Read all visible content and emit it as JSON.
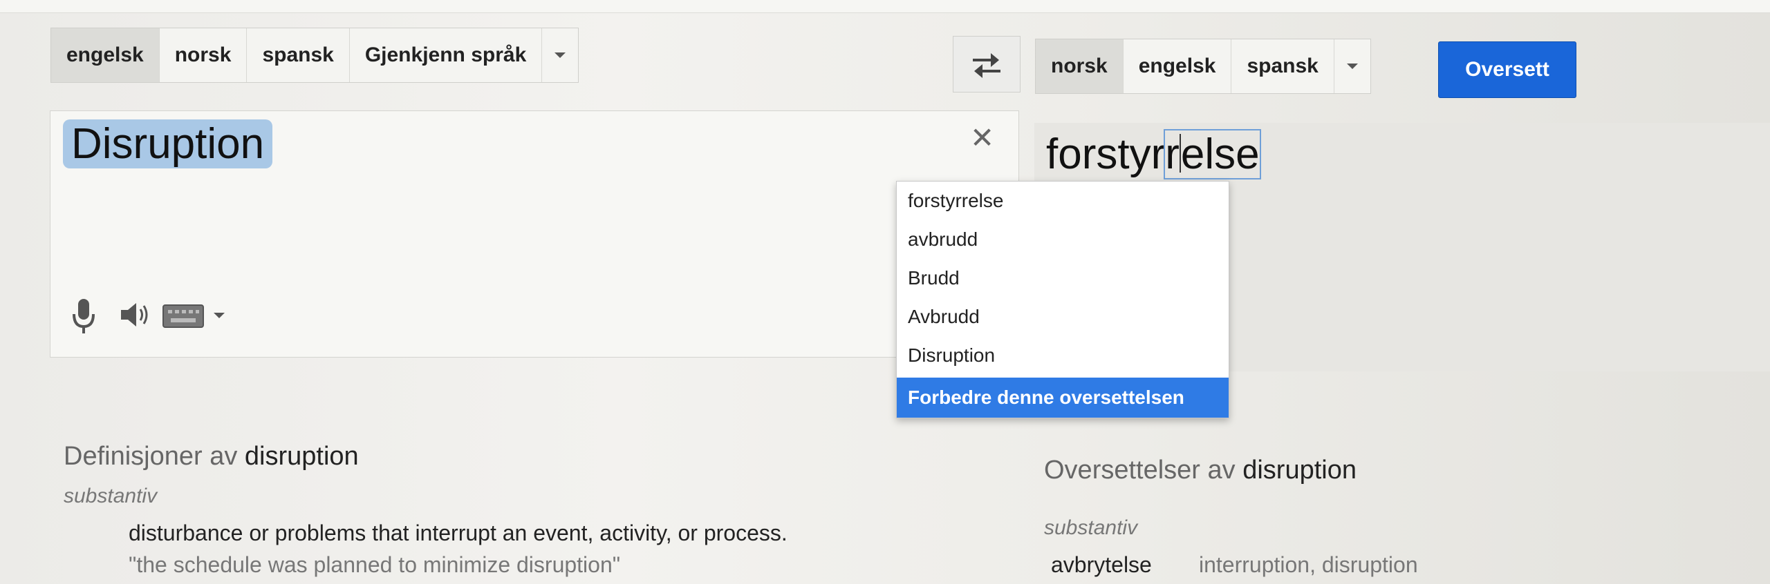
{
  "source_langs": {
    "tabs": [
      "engelsk",
      "norsk",
      "spansk",
      "Gjenkjenn språk"
    ],
    "active": "engelsk"
  },
  "target_langs": {
    "tabs": [
      "norsk",
      "engelsk",
      "spansk"
    ],
    "active": "norsk"
  },
  "translate_button": "Oversett",
  "source": {
    "text": "Disruption"
  },
  "target": {
    "pre": "forstyr",
    "mid": "r",
    "post": "else"
  },
  "suggestions": {
    "items": [
      "forstyrrelse",
      "avbrudd",
      "Brudd",
      "Avbrudd",
      "Disruption"
    ],
    "improve": "Forbedre denne oversettelsen"
  },
  "definitions": {
    "title_prefix": "Definisjoner av",
    "word": "disruption",
    "pos": "substantiv",
    "text": "disturbance or problems that interrupt an event, activity, or process.",
    "example": "\"the schedule was planned to minimize disruption\""
  },
  "translations": {
    "title_prefix": "Oversettelser av",
    "word": "disruption",
    "pos": "substantiv",
    "entry_word": "avbrytelse",
    "entry_meanings": "interruption, disruption"
  },
  "colors": {
    "accent": "#1a66d9",
    "highlight": "#a9c8e6",
    "menu_selected": "#2f7be5"
  }
}
